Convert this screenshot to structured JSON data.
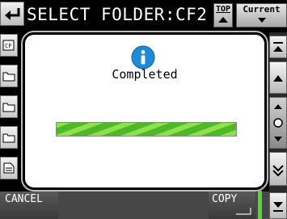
{
  "header": {
    "title": "SELECT FOLDER:CF2",
    "top_label": "TOP",
    "current_label": "Current"
  },
  "dialog": {
    "message": "Completed",
    "progress": 1.0
  },
  "footer": {
    "cancel_label": "CANCEL",
    "copy_label": "COPY"
  },
  "icons": {
    "info": "info-icon",
    "back": "back-arrow-icon"
  },
  "colors": {
    "info_blue": "#1f8ad6",
    "progress_green": "#5cc23a",
    "ready_indicator": "#5cd33a"
  }
}
